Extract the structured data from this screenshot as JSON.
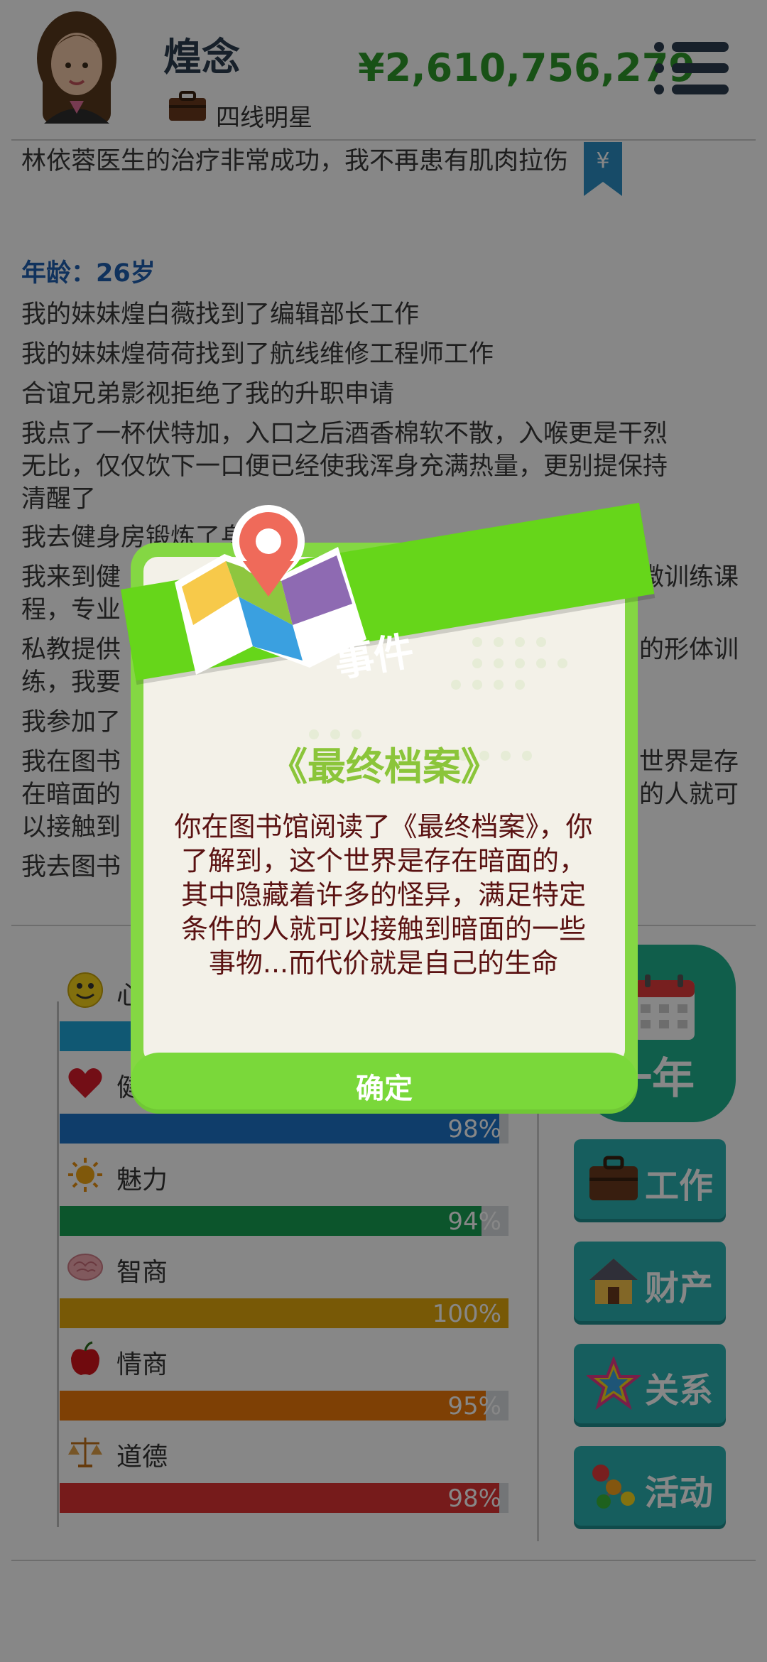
{
  "header": {
    "player_name": "煌念",
    "job_title": "四线明星",
    "money": "¥2,610,756,279",
    "icons": {
      "avatar": "avatar-female",
      "job": "briefcase-icon",
      "menu": "menu-icon",
      "bookmark": "yen-bookmark-icon"
    }
  },
  "log": {
    "lines": [
      "林依蓉医生的治疗非常成功，我不再患有肌肉拉伤",
      "年龄：26岁",
      "我的妹妹煌白薇找到了编辑部长工作",
      "我的妹妹煌荷荷找到了航线维修工程师工作",
      "合谊兄弟影视拒绝了我的升职申请",
      "我点了一杯伏特加，入口之后酒香棉软不散，入喉更是干烈",
      "无比，仅仅饮下一口便已经使我浑身充满热量，更别提保持",
      "清醒了",
      "我去健身房锻炼了身体",
      "我来到健",
      "微训练课",
      "程，专业",
      "私教提供",
      "的形体训",
      "练，我要",
      "我参加了",
      "我在图书",
      "世界是存",
      "在暗面的",
      "的人就可",
      "以接触到",
      "我去图书"
    ]
  },
  "stats": [
    {
      "key": "mood",
      "label": "心情",
      "value": 100,
      "pct_label": "",
      "color": "#1fa7d9",
      "icon": "smiley-icon"
    },
    {
      "key": "health",
      "label": "健康",
      "value": 98,
      "pct_label": "98%",
      "color": "#1d73c9",
      "icon": "heart-icon"
    },
    {
      "key": "charm",
      "label": "魅力",
      "value": 94,
      "pct_label": "94%",
      "color": "#17a053",
      "icon": "sun-icon"
    },
    {
      "key": "iq",
      "label": "智商",
      "value": 100,
      "pct_label": "100%",
      "color": "#e2a80c",
      "icon": "brain-icon"
    },
    {
      "key": "eq",
      "label": "情商",
      "value": 95,
      "pct_label": "95%",
      "color": "#ee7a0b",
      "icon": "apple-icon"
    },
    {
      "key": "morality",
      "label": "道德",
      "value": 98,
      "pct_label": "98%",
      "color": "#df3333",
      "icon": "scales-icon"
    }
  ],
  "buttons": {
    "year": "一年",
    "work": "工作",
    "property": "财产",
    "relation": "关系",
    "activity": "活动"
  },
  "dialog": {
    "ribbon": "事件",
    "title": "《最终档案》",
    "body": "你在图书馆阅读了《最终档案》，你了解到，这个世界是存在暗面的，其中隐藏着许多的怪异，满足特定条件的人就可以接触到暗面的一些事物...而代价就是自己的生命",
    "confirm": "确定",
    "icon": "map-pin-icon"
  }
}
